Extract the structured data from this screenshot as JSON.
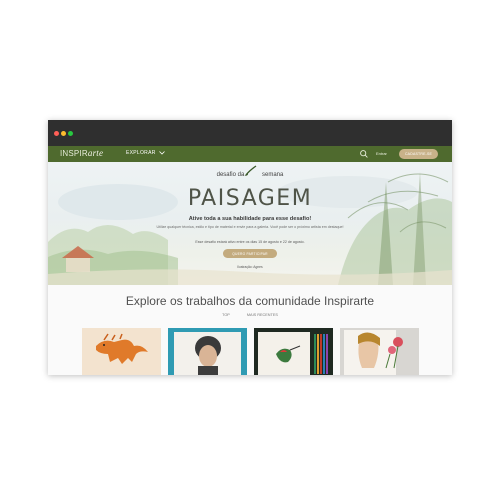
{
  "nav": {
    "logo_text": "INSPIR",
    "logo_script": "arte",
    "explore_label": "EXPLORAR",
    "login_label": "Entrar",
    "signup_label": "CADASTRE-SE"
  },
  "hero": {
    "kicker_left": "desafio da",
    "kicker_right": "semana",
    "theme": "PAISAGEM",
    "tagline": "Ative toda a sua habilidade para esse desafio!",
    "subtitle": "Utilize qualquer técnica, estilo e tipo de material e envie para a galeria. Você pode ser o próximo artista em destaque!",
    "dates": "Esse desafio estará ativo entre os dias 15 de agosto e 22 de agosto.",
    "cta_label": "QUERO PARTICIPAR",
    "credit": "Ilustração: Agnes"
  },
  "community": {
    "title": "Explore os trabalhos da comunidade Inspirarte",
    "tabs": [
      "TOP",
      "MAIS RECENTES"
    ]
  },
  "colors": {
    "nav": "#4f6a2e",
    "accent": "#c8b289"
  },
  "icons": {
    "search": "search-icon",
    "chevron": "chevron-down-icon",
    "brush": "brush-icon"
  }
}
